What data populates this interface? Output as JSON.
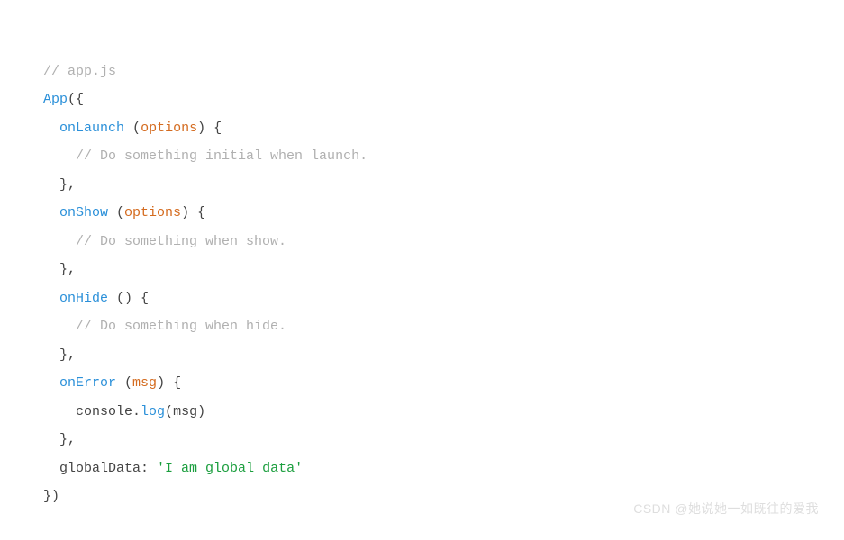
{
  "code": {
    "line1_comment": "// app.js",
    "line2_app": "App",
    "line2_paren_open": "(",
    "line2_brace_open": "{",
    "line3_method": "onLaunch",
    "line3_space": " ",
    "line3_paren_open": "(",
    "line3_param": "options",
    "line3_paren_close": ")",
    "line3_brace_open": " {",
    "line4_comment": "// Do something initial when launch.",
    "line5_close": "},",
    "line6_method": "onShow",
    "line6_paren_open": " (",
    "line6_param": "options",
    "line6_paren_close": ")",
    "line6_brace_open": " {",
    "line7_comment": "// Do something when show.",
    "line8_close": "},",
    "line9_method": "onHide",
    "line9_rest": " () {",
    "line10_comment": "// Do something when hide.",
    "line11_close": "},",
    "line12_method": "onError",
    "line12_paren_open": " (",
    "line12_param": "msg",
    "line12_paren_close": ")",
    "line12_brace_open": " {",
    "line13_console": "console.",
    "line13_log": "log",
    "line13_paren_open": "(",
    "line13_arg": "msg",
    "line13_paren_close": ")",
    "line14_close": "},",
    "line15_key": "globalData",
    "line15_colon": ": ",
    "line15_string": "'I am global data'",
    "line16_close": "})"
  },
  "watermark": "CSDN @她说她一如既往的爱我"
}
